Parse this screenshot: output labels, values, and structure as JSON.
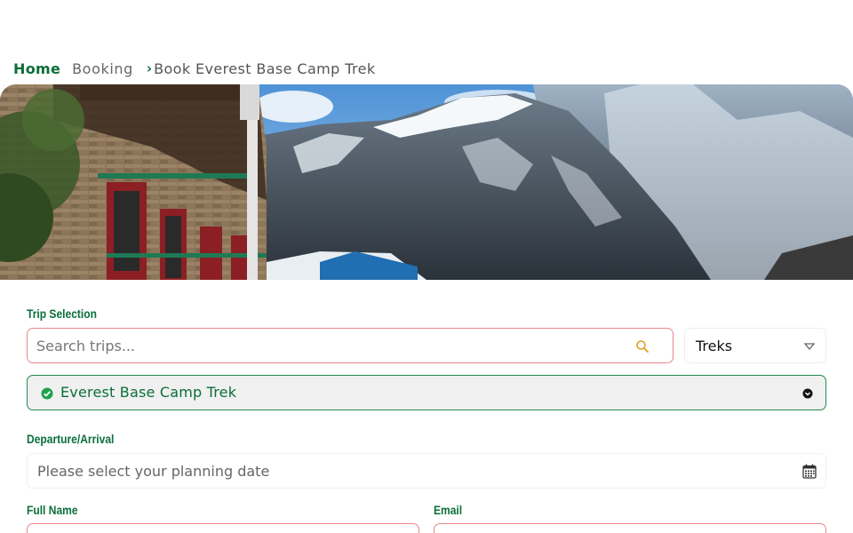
{
  "breadcrumb": {
    "home": "Home",
    "booking": "Booking",
    "separator": "›",
    "current": "Book Everest Base Camp Trek"
  },
  "hero": {
    "image_description_icon": "mountain-lodge-photo"
  },
  "form": {
    "trip_selection_label": "Trip Selection",
    "search_placeholder": "Search trips...",
    "category_value": "Treks",
    "selected_trip": "Everest Base Camp Trek",
    "departure_label": "Departure/Arrival",
    "date_placeholder": "Please select your planning date",
    "full_name_label": "Full Name",
    "email_label": "Email"
  },
  "colors": {
    "accent": "#0b6e3a",
    "error_border": "#e8868a",
    "search_icon": "#e0a020"
  }
}
